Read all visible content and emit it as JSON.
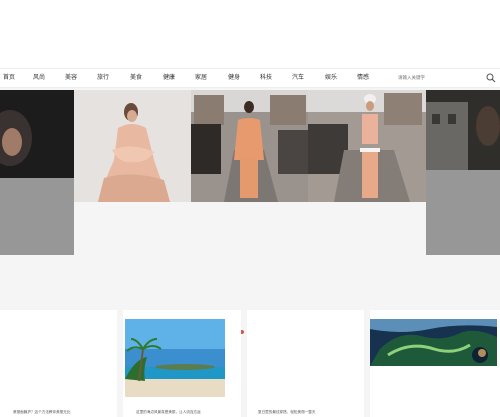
{
  "nav": {
    "items": [
      {
        "label": "首页"
      },
      {
        "label": "风尚"
      },
      {
        "label": "美容"
      },
      {
        "label": "旅行"
      },
      {
        "label": "美食"
      },
      {
        "label": "健康"
      },
      {
        "label": "家居"
      },
      {
        "label": "健身"
      },
      {
        "label": "科技"
      },
      {
        "label": "汽车"
      },
      {
        "label": "娱乐"
      },
      {
        "label": "情感"
      }
    ],
    "search": {
      "placeholder": "请输入关键字"
    }
  },
  "cards": [
    {
      "caption": "美丽面膜护？这个方法教你美丽无比"
    },
    {
      "caption": "这里的海边风景真是美丽，让人流连忘返"
    },
    {
      "caption": "夏日里的最佳穿搭，轻松美丽一整天"
    },
    {
      "caption": ""
    }
  ],
  "colors": {
    "accent": "#d9534f"
  },
  "icons": {
    "search": "search-icon"
  }
}
